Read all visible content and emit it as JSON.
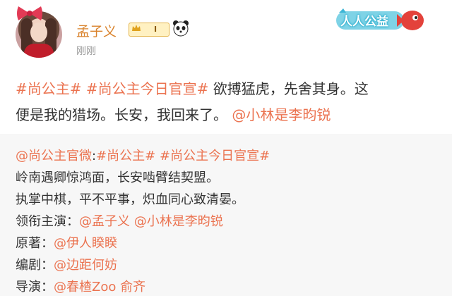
{
  "post": {
    "username": "孟子义",
    "vip_label": "I",
    "timestamp": "刚刚",
    "charity_badge": "人人公益",
    "text": {
      "hashtag1": "#尚公主#",
      "hashtag2": "#尚公主今日官宣#",
      "body1": " 欲搏猛虎，先舍其身。这",
      "body2": "便是我的猎场。长安，我回来了。",
      "mention": "@小林是李昀锐"
    }
  },
  "repost": {
    "author": "@尚公主官微",
    "colon": ":",
    "hashtag1": "#尚公主#",
    "hashtag2": "#尚公主今日官宣#",
    "line2": "岭南遇卿惊鸿面，长安啮臂结契盟。",
    "line3": "执掌中棋，平不平事，炽血同心致清晏。",
    "line4_label": "领衔主演：",
    "line4_m1": "@孟子义",
    "line4_m2": "@小林是李昀锐",
    "line5_label": "原著：",
    "line5_m1": "@伊人睽睽",
    "line6_label": "编剧：",
    "line6_m1": "@边距何妨",
    "line7_label": "导演：",
    "line7_m1": "@春楂Zoo",
    "line7_m2": "俞齐"
  },
  "colors": {
    "link": "#eb7350",
    "username": "#d9822b",
    "repost_bg": "#f7f7f7"
  },
  "icons": [
    "avatar-bow-icon",
    "crown-icon",
    "panda-icon",
    "charity-fish-icon"
  ]
}
